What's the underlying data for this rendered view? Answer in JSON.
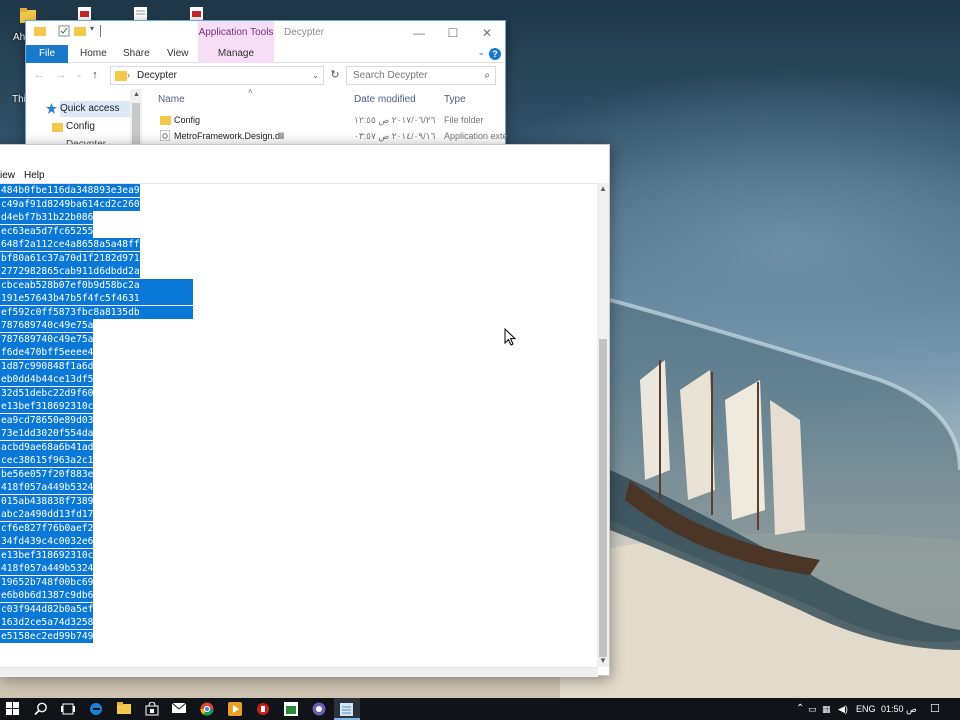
{
  "desktop": {
    "icon_labels": [
      "Ah",
      "Thi"
    ]
  },
  "explorer": {
    "title": "Decypter",
    "context_tab": "Application Tools",
    "manage_tab": "Manage",
    "ribbon_tabs": [
      "File",
      "Home",
      "Share",
      "View"
    ],
    "address": "Decypter",
    "search_placeholder": "Search Decypter",
    "nav_items": [
      "Quick access",
      "Config",
      "Decypter"
    ],
    "columns": [
      "Name",
      "Date modified",
      "Type"
    ],
    "rows": [
      {
        "name": "Config",
        "date": "٢٠١٧/٠٦/٢٦ ص ١٢:٥٥",
        "type": "File folder"
      },
      {
        "name": "MetroFramework.Design.dll",
        "date": "٢٠١٤/٠٩/١٦ ص ٠٣:٥٧",
        "type": "Application exte"
      }
    ]
  },
  "notepad": {
    "menu": [
      "iew",
      "Help"
    ],
    "lines": [
      "484b0fbe116da348893e3ea9",
      "c49af91d8249ba614cd2c260",
      "d4ebf7b31b22b086",
      "ec63ea5d7fc65255",
      "648f2a112ce4a8658a5a48ff",
      "bf80a61c37a70d1f2182d971",
      "2772982865cab911d6dbdd2a",
      "cbceab528b07ef0b9d58bc2a",
      "191e57643b47b5f4fc5f4631",
      "ef592c0ff5873fbc8a8135db",
      "787689740c49e75a",
      "787689740c49e75a",
      "f6de470bff5eeee4",
      "1d87c990848f1a6d",
      "eb0dd4b44ce13df5",
      "32d51debc22d9f60",
      "e13bef318692310c",
      "ea9cd78650e89d03",
      "73e1dd3020f554da",
      "acbd9ae68a6b41ad",
      "cec38615f963a2c1",
      "be56e057f20f883e",
      "418f057a449b5324",
      "015ab438838f7389",
      "abc2a490dd13fd17",
      "cf6e827f76b0aef2",
      "34fd439c4c0032e6",
      "e13bef318692310c",
      "418f057a449b5324",
      "19652b748f00bc69",
      "e6b0b6d1387c9db6",
      "c03f944d82b0a5ef",
      "163d2ce5a74d3258",
      "e5158ec2ed99b749"
    ]
  },
  "taskbar": {
    "language": "ENG",
    "clock": "01:50 ص"
  },
  "colors": {
    "selection": "#0a78d7",
    "file_tab": "#1979ca",
    "taskbar": "#101418"
  }
}
